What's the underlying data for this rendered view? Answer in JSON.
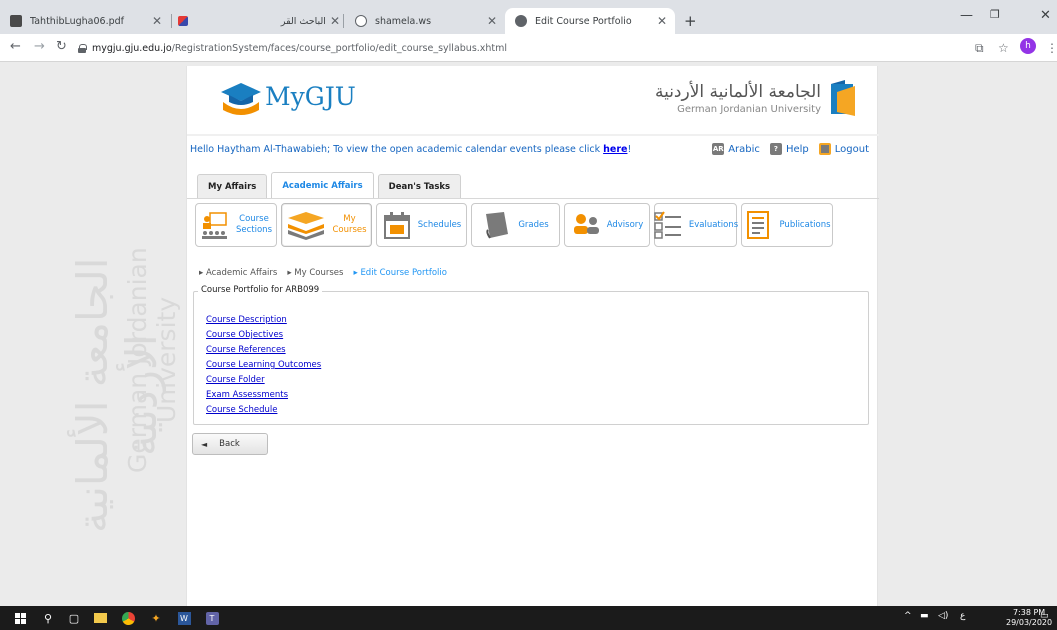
{
  "browser": {
    "tabs": [
      {
        "title": "TahthibLugha06.pdf",
        "favicon": "pdf-icon"
      },
      {
        "title": "",
        "favicon": "app-icon"
      },
      {
        "title": "الباحث القرآني",
        "favicon": "page-icon"
      },
      {
        "title": "shamela.ws",
        "favicon": "globe-icon"
      },
      {
        "title": "Edit Course Portfolio",
        "favicon": "globe-icon"
      }
    ],
    "url_host": "mygju.gju.edu.jo",
    "url_path": "/RegistrationSystem/faces/course_portfolio/edit_course_syllabus.xhtml",
    "profile_initial": "h"
  },
  "watermark": {
    "arabic": "الجامعة الألمانية الأردنية",
    "english": "German Jordanian University"
  },
  "header": {
    "logo_text": "MyGJU",
    "university_ar": "الجامعة الألمانية الأردنية",
    "university_en": "German Jordanian University"
  },
  "greeting": {
    "text": "Hello Haytham Al-Thawabieh;  To view the open academic calendar events please click ",
    "link": "here",
    "suffix": "!"
  },
  "toplinks": {
    "arabic": "Arabic",
    "arabic_badge": "AR",
    "help": "Help",
    "logout": "Logout"
  },
  "tabs": [
    {
      "label": "My Affairs"
    },
    {
      "label": "Academic Affairs"
    },
    {
      "label": "Dean's Tasks"
    }
  ],
  "modules": [
    {
      "line1": "Course",
      "line2": "Sections"
    },
    {
      "line1": "My",
      "line2": "Courses"
    },
    {
      "line1": "Schedules",
      "line2": ""
    },
    {
      "line1": "Grades",
      "line2": ""
    },
    {
      "line1": "Advisory",
      "line2": ""
    },
    {
      "line1": "Evaluations",
      "line2": ""
    },
    {
      "line1": "Publications",
      "line2": ""
    }
  ],
  "breadcrumb": [
    "Academic Affairs",
    "My Courses",
    "Edit Course Portfolio"
  ],
  "portfolio": {
    "legend": "Course Portfolio for ARB099",
    "links": [
      "Course Description",
      "Course Objectives",
      "Course References",
      "Course Learning Outcomes",
      "Course Folder",
      "Exam Assessments",
      "Course Schedule"
    ]
  },
  "back_label": "Back",
  "taskbar": {
    "time": "7:38 PM",
    "date": "29/03/2020",
    "lang": "ع"
  }
}
